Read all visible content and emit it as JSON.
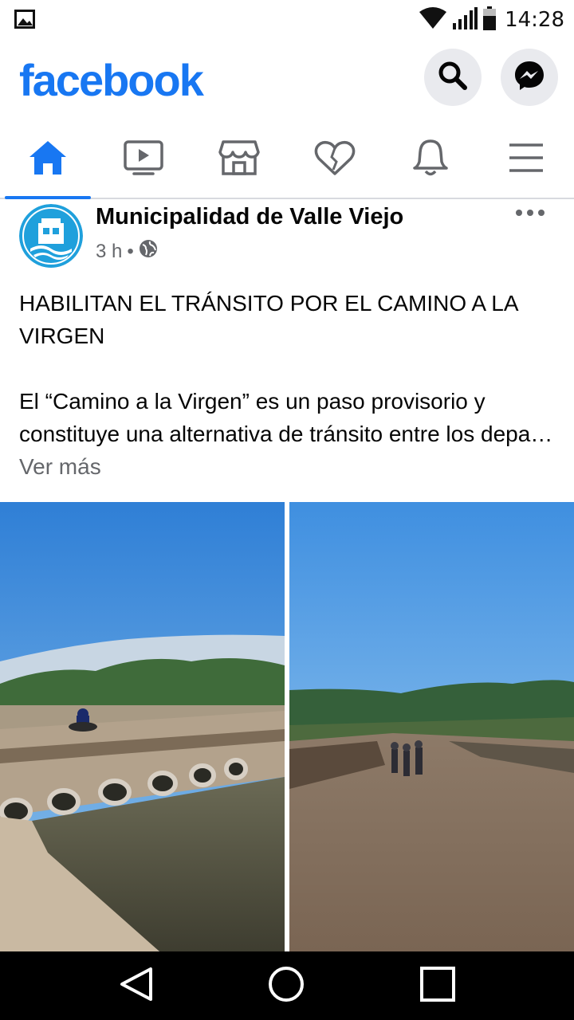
{
  "status_bar": {
    "time": "14:28",
    "icons": [
      "image-notification-icon",
      "wifi-icon",
      "signal-icon",
      "battery-icon"
    ]
  },
  "header": {
    "logo_text": "facebook",
    "brand_color": "#1877f2",
    "buttons": [
      "search-icon",
      "messenger-icon"
    ]
  },
  "tabs": [
    {
      "name": "home",
      "icon": "home-icon",
      "active": true
    },
    {
      "name": "watch",
      "icon": "video-icon",
      "active": false
    },
    {
      "name": "marketplace",
      "icon": "store-icon",
      "active": false
    },
    {
      "name": "dating",
      "icon": "heart-icon",
      "active": false
    },
    {
      "name": "notifications",
      "icon": "bell-icon",
      "active": false
    },
    {
      "name": "menu",
      "icon": "hamburger-icon",
      "active": false
    }
  ],
  "post": {
    "author": "Municipalidad de Valle Viejo",
    "time": "3 h",
    "separator": "•",
    "privacy_icon": "globe-icon",
    "headline": "HABILITAN EL TRÁNSITO POR EL CAMINO A LA VIRGEN",
    "body": "El “Camino a la Virgen” es un paso provisorio y constituye una alternativa de tránsito entre los depa…",
    "see_more": "Ver más",
    "photos": [
      "river-crossing-culverts-photo",
      "dirt-road-people-photo"
    ]
  },
  "nav_bar": [
    "back-icon",
    "home-circle-icon",
    "recents-icon"
  ]
}
